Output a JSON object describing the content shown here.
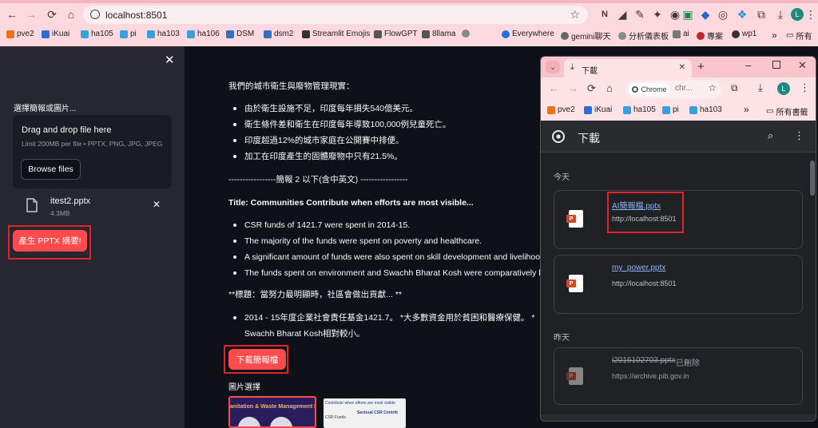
{
  "browser": {
    "url": "localhost:8501",
    "bookmarks": [
      "pve2",
      "iKuai",
      "ha105",
      "pi",
      "ha103",
      "ha106",
      "DSM",
      "dsm2",
      "Streamlit Emojis",
      "FlowGPT",
      "8llama",
      "",
      "Everywhere",
      "gemini聊天",
      "分析儀表板",
      "ai",
      "專案",
      "wp1"
    ],
    "all_bookmarks": "所有",
    "profile_initial": "L"
  },
  "sidebar": {
    "label": "選擇簡報或圖片...",
    "uploader_title": "Drag and drop file here",
    "uploader_limit": "Limit 200MB per file • PPTX, PNG, JPG, JPEG",
    "browse_button": "Browse files",
    "file_name": "itest2.pptx",
    "file_size": "4.3MB",
    "generate_button": "產生 PPTX 摘要!"
  },
  "main": {
    "intro": "我們的城市衛生與廢物管理現實：",
    "zh_bullets": [
      "由於衛生設施不足，印度每年損失540億美元。",
      "衛生條件差和衛生在印度每年導致100,000例兒童死亡。",
      "印度超過12%的城市家庭在公開賽中排便。",
      "加工在印度產生的固體廢物中只有21.5%。"
    ],
    "separator": "-----------------簡報 2 以下(含中英文) -----------------",
    "title2": "Title: Communities Contribute when efforts are most visible...",
    "en_bullets": [
      "CSR funds of 1421.7 were spent in 2014-15.",
      "The majority of the funds were spent on poverty and healthcare.",
      "A significant amount of funds were also spent on skill development and livelihood",
      "The funds spent on environment and Swachh Bharat Kosh were comparatively les"
    ],
    "zh_title": "**標題：當努力最明顯時，社區會做出貢獻... **",
    "zh_last_line1": "2014 - 15年度企業社會責任基金1421.7。 *大多數資金用於貧困和醫療保健。 *",
    "zh_last_line2": "Swachh Bharat Kosh相對較小。",
    "download_button": "下載簡報檔",
    "images_label": "圖片選擇",
    "thumb1_text": "anitation & Waste Management Re",
    "thumb2_text": "Contribute when efforts are most visible",
    "thumb2_sub": "Sectoral CSR Contrib",
    "thumb2_sub2": "CSR Funds"
  },
  "downloads": {
    "tab_title": "下載",
    "tab_new": "+",
    "omni_chip": "Chrome",
    "omni_text": "chr...",
    "profile_initial": "L",
    "bookmarks": [
      "pve2",
      "iKuai",
      "ha105",
      "pi",
      "ha103"
    ],
    "more": "»",
    "all_bookmarks": "所有書籤",
    "header_title": "下載",
    "today_label": "今天",
    "yesterday_label": "昨天",
    "items": [
      {
        "name": "AI簡報檔.pptx",
        "source": "http://localhost:8501",
        "status": ""
      },
      {
        "name": "my_power.pptx",
        "source": "http://localhost:8501",
        "status": ""
      },
      {
        "name": "i2016102703.pptx",
        "source": "https://archive.pib.gov.in",
        "status": "已刪除"
      }
    ],
    "file_badge": "P"
  },
  "colors": {
    "accent": "#ff4b4b",
    "highlight_box": "#e0242b",
    "link": "#8ab4f8"
  }
}
